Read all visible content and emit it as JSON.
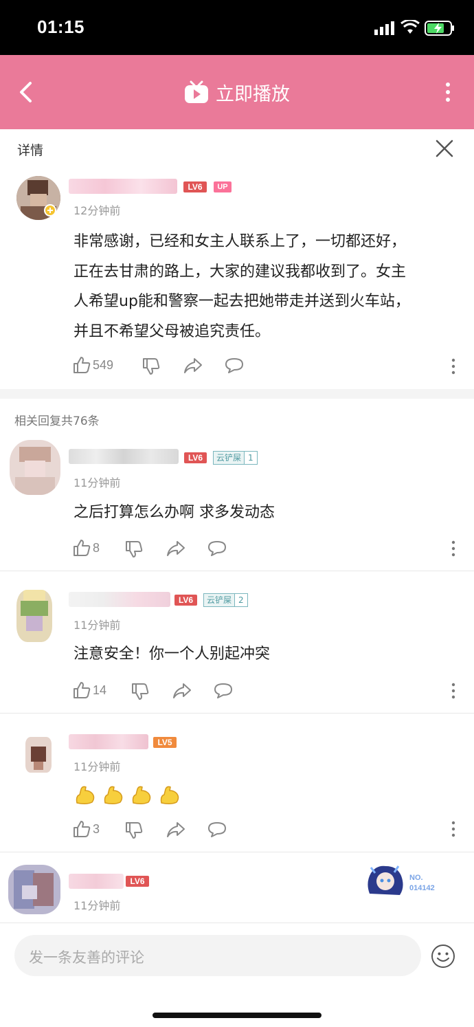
{
  "status_bar": {
    "time": "01:15"
  },
  "app_bar": {
    "title": "立即播放"
  },
  "detail_bar": {
    "label": "详情"
  },
  "main_comment": {
    "level": "LV6",
    "up_badge": "UP",
    "time": "12分钟前",
    "lines": [
      "非常感谢，已经和女主人联系上了，一切都还好，",
      "正在去甘肃的路上，大家的建议我都收到了。女主",
      "人希望up能和警察一起去把她带走并送到火车站，",
      "并且不希望父母被追究责任。"
    ],
    "like_count": "549"
  },
  "replies_header": "相关回复共76条",
  "replies": [
    {
      "level": "LV6",
      "fan_badge": "云铲屎",
      "fan_level": "1",
      "time": "11分钟前",
      "text": "之后打算怎么办啊 求多发动态",
      "like_count": "8"
    },
    {
      "level": "LV6",
      "fan_badge": "云铲屎",
      "fan_level": "2",
      "time": "11分钟前",
      "text": "注意安全！你一个人别起冲突",
      "like_count": "14"
    },
    {
      "level": "LV5",
      "time": "11分钟前",
      "emojis": [
        "💪",
        "💪",
        "💪",
        "💪"
      ],
      "like_count": "3"
    },
    {
      "level": "LV6",
      "time": "11分钟前",
      "badge_no": "NO.",
      "badge_num": "014142"
    }
  ],
  "comment_input": {
    "placeholder": "发一条友善的评论"
  },
  "colors": {
    "brand_pink": "#ea7a99",
    "lv6": "#e05555",
    "lv5": "#f08a3c"
  }
}
